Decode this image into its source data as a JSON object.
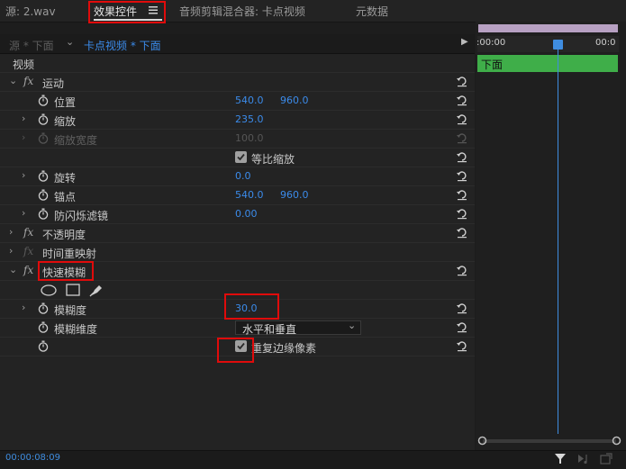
{
  "tabs": {
    "source": "源: 2.wav",
    "effects": "效果控件",
    "effects_menu_icon": "hamburger-icon",
    "audio_mixer": "音频剪辑混合器: 卡点视频",
    "metadata": "元数据"
  },
  "source_bar": {
    "master": "源 * 下面",
    "sequence": "卡点视频 * 下面",
    "ruler_start": ":00:00",
    "ruler_end": "00:0",
    "clip_name": "下面"
  },
  "section": "视频",
  "rows": {
    "motion": "运动",
    "position": {
      "label": "位置",
      "x": "540.0",
      "y": "960.0"
    },
    "scale": {
      "label": "缩放",
      "value": "235.0"
    },
    "scale_width": {
      "label": "缩放宽度",
      "value": "100.0"
    },
    "uniform_scale": "等比缩放",
    "rotation": {
      "label": "旋转",
      "value": "0.0"
    },
    "anchor": {
      "label": "锚点",
      "x": "540.0",
      "y": "960.0"
    },
    "anti_flicker": {
      "label": "防闪烁滤镜",
      "value": "0.00"
    },
    "opacity": "不透明度",
    "time_remap": "时间重映射",
    "fast_blur": "快速模糊",
    "blurriness": {
      "label": "模糊度",
      "value": "30.0"
    },
    "blur_dimensions": {
      "label": "模糊维度",
      "value": "水平和垂直"
    },
    "repeat_edge": "重复边缘像素"
  },
  "footer": {
    "timecode": "00:00:08:09"
  },
  "colors": {
    "accent": "#3b8bea",
    "clip": "#3fae49",
    "highlight": "#e00b0b"
  }
}
